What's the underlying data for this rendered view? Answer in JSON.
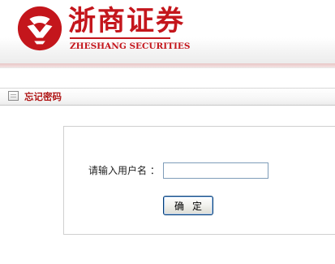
{
  "brand": {
    "name_cn": "浙商证券",
    "name_en": "ZHESHANG SECURITIES",
    "color": "#c4161c"
  },
  "section": {
    "title": "忘记密码",
    "icon": "document-icon"
  },
  "form": {
    "username_label": "请输入用户名 ：",
    "username_value": "",
    "confirm_label": "确定"
  }
}
